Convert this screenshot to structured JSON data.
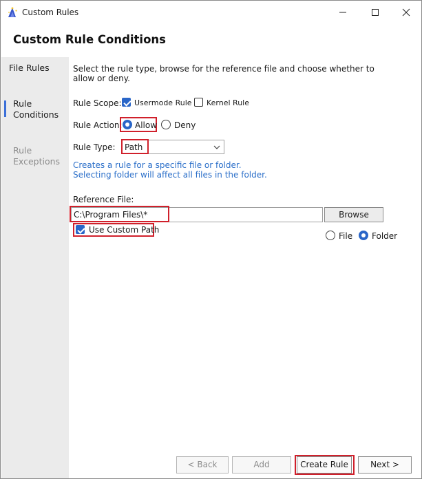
{
  "window": {
    "title": "Custom Rules",
    "controls": {
      "minimize": "minimize",
      "maximize": "maximize",
      "close": "close"
    }
  },
  "header": {
    "title": "Custom Rule Conditions"
  },
  "sidebar": {
    "items": [
      {
        "label": "File Rules",
        "state": "normal"
      },
      {
        "label": "Rule\nConditions",
        "state": "active"
      },
      {
        "label": "Rule\nExceptions",
        "state": "disabled"
      }
    ]
  },
  "main": {
    "description": "Select the rule type, browse for the reference file and choose whether to allow or deny.",
    "rule_scope": {
      "label": "Rule Scope:",
      "options": [
        {
          "label": "Usermode Rule",
          "checked": true
        },
        {
          "label": "Kernel Rule",
          "checked": false
        }
      ]
    },
    "rule_action": {
      "label": "Rule Action:",
      "options": [
        {
          "label": "Allow",
          "selected": true
        },
        {
          "label": "Deny",
          "selected": false
        }
      ]
    },
    "rule_type": {
      "label": "Rule Type:",
      "value": "Path"
    },
    "hint_lines": [
      "Creates a rule for a specific file or folder.",
      "Selecting folder will affect all files in the folder."
    ],
    "reference_file": {
      "label": "Reference File:",
      "value": "C:\\Program Files\\*",
      "browse_label": "Browse"
    },
    "use_custom_path": {
      "label": "Use Custom Path",
      "checked": true
    },
    "path_kind": {
      "options": [
        {
          "label": "File",
          "selected": false
        },
        {
          "label": "Folder",
          "selected": true
        }
      ]
    }
  },
  "footer": {
    "back_label": "< Back",
    "add_label": "Add",
    "create_label": "Create Rule",
    "next_label": "Next >"
  },
  "colors": {
    "accent": "#2a66c8",
    "hint_text": "#2b6fc9",
    "highlight": "#d0202b",
    "sidebar_bg": "#ebebeb"
  }
}
